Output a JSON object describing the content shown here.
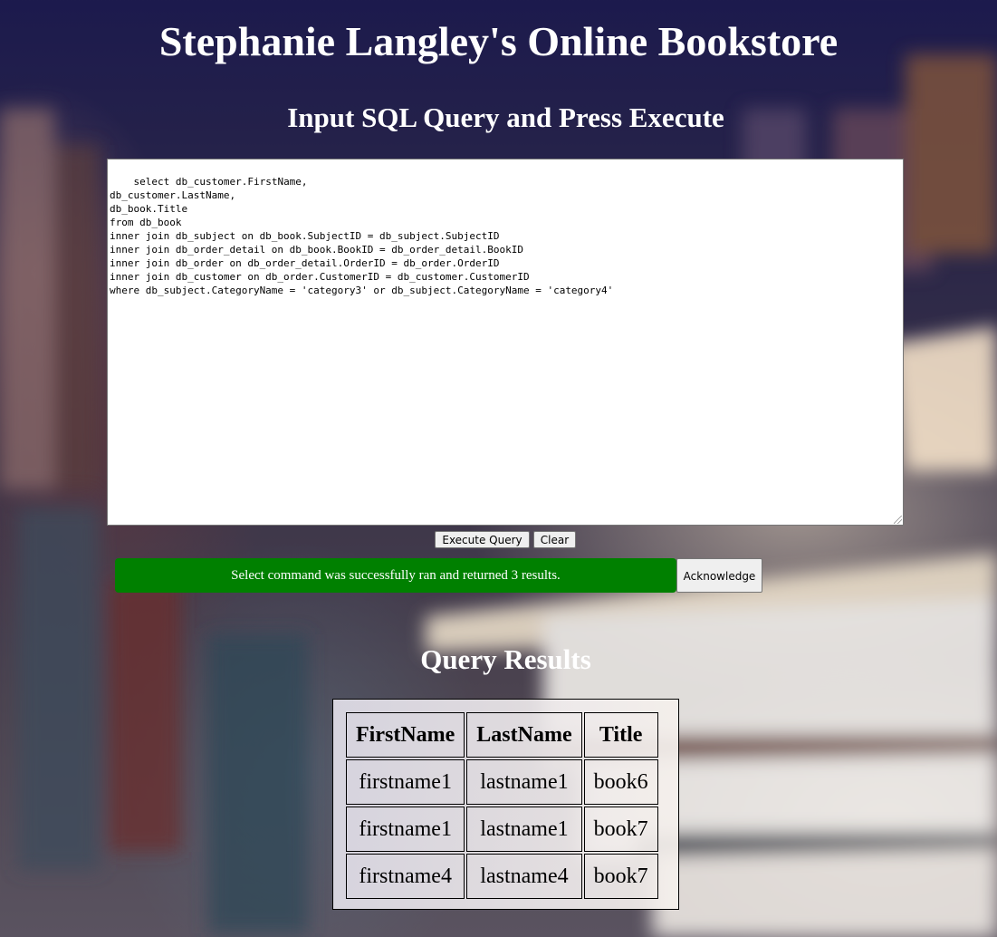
{
  "page": {
    "title": "Stephanie Langley's Online Bookstore",
    "query_heading": "Input SQL Query and Press Execute",
    "results_heading": "Query Results"
  },
  "query": {
    "text": "select db_customer.FirstName,\ndb_customer.LastName,\ndb_book.Title\nfrom db_book\ninner join db_subject on db_book.SubjectID = db_subject.SubjectID\ninner join db_order_detail on db_book.BookID = db_order_detail.BookID\ninner join db_order on db_order_detail.OrderID = db_order.OrderID\ninner join db_customer on db_order.CustomerID = db_customer.CustomerID\nwhere db_subject.CategoryName = 'category3' or db_subject.CategoryName = 'category4'"
  },
  "buttons": {
    "execute_label": "Execute Query",
    "clear_label": "Clear",
    "acknowledge_label": "Acknowledge"
  },
  "status": {
    "message": "Select command was successfully ran and returned 3 results.",
    "color": "#008000"
  },
  "results": {
    "columns": [
      "FirstName",
      "LastName",
      "Title"
    ],
    "rows": [
      [
        "firstname1",
        "lastname1",
        "book6"
      ],
      [
        "firstname1",
        "lastname1",
        "book7"
      ],
      [
        "firstname4",
        "lastname4",
        "book7"
      ]
    ]
  }
}
